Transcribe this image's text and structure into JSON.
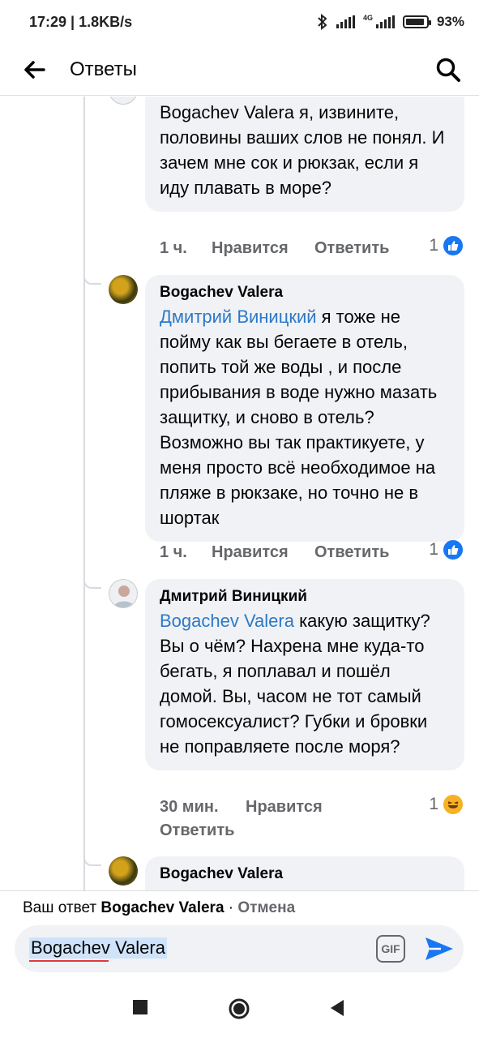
{
  "status_bar": {
    "time_speed": "17:29 | 1.8KB/s",
    "network": "4G",
    "battery": "93%"
  },
  "header": {
    "title": "Ответы"
  },
  "comments": [
    {
      "text": "Bogachev Valera я, извините, половины ваших слов не понял. И зачем мне сок и рюкзак, если я иду плавать в море?",
      "time": "1 ч.",
      "like_label": "Нравится",
      "reply_label": "Ответить",
      "reaction_count": "1",
      "reaction": "like"
    },
    {
      "author": "Bogachev Valera",
      "mention": "Дмитрий Виницкий",
      "text": "я тоже не пойму как вы бегаете в отель, попить той же воды , и после прибывания в воде нужно мазать защитку, и сново в отель? Возможно вы так практикуете, у меня просто всё необходимое на пляже в рюкзаке, но точно не в шортак",
      "time": "1 ч.",
      "like_label": "Нравится",
      "reply_label": "Ответить",
      "reaction_count": "1",
      "reaction": "like"
    },
    {
      "author": "Дмитрий Виницкий",
      "mention": "Bogachev Valera",
      "text": "какую защитку? Вы о чём? Нахрена мне куда-то бегать, я поплавал и пошёл домой. Вы, часом не тот самый гомосексуалист? Губки и бровки не поправляете после моря?",
      "time": "30 мин.",
      "like_label": "Нравится",
      "reply_label": "Ответить",
      "reaction_count": "1",
      "reaction": "haha"
    },
    {
      "author": "Bogachev Valera"
    }
  ],
  "reply_bar": {
    "prefix": "Ваш ответ",
    "target": "Bogachev Valera",
    "separator": "·",
    "cancel": "Отмена",
    "input_value": "Bogachev Valera",
    "gif_label": "GIF"
  },
  "colors": {
    "mention": "#2d79c7",
    "bubble": "#f0f2f5",
    "accent": "#1877f2"
  }
}
